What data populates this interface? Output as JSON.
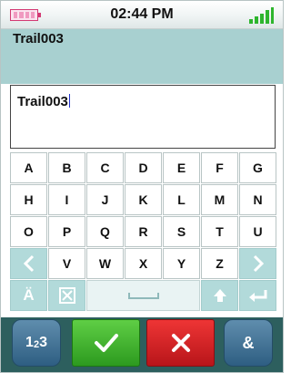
{
  "status": {
    "time": "02:44 PM"
  },
  "field": {
    "title": "Trail003",
    "value": "Trail003"
  },
  "keyboard": {
    "rows": [
      [
        "A",
        "B",
        "C",
        "D",
        "E",
        "F",
        "G"
      ],
      [
        "H",
        "I",
        "J",
        "K",
        "L",
        "M",
        "N"
      ],
      [
        "O",
        "P",
        "Q",
        "R",
        "S",
        "T",
        "U"
      ],
      [
        "V",
        "W",
        "X",
        "Y",
        "Z"
      ]
    ],
    "umlaut_label": "Ä"
  },
  "bottom": {
    "numeric_label": "1",
    "numeric_sub_label": "2",
    "numeric_label_end": "3",
    "symbols_label": "&"
  },
  "colors": {
    "ok": "#3cb52c",
    "cancel": "#d92027",
    "accent": "#a8d0d0"
  }
}
